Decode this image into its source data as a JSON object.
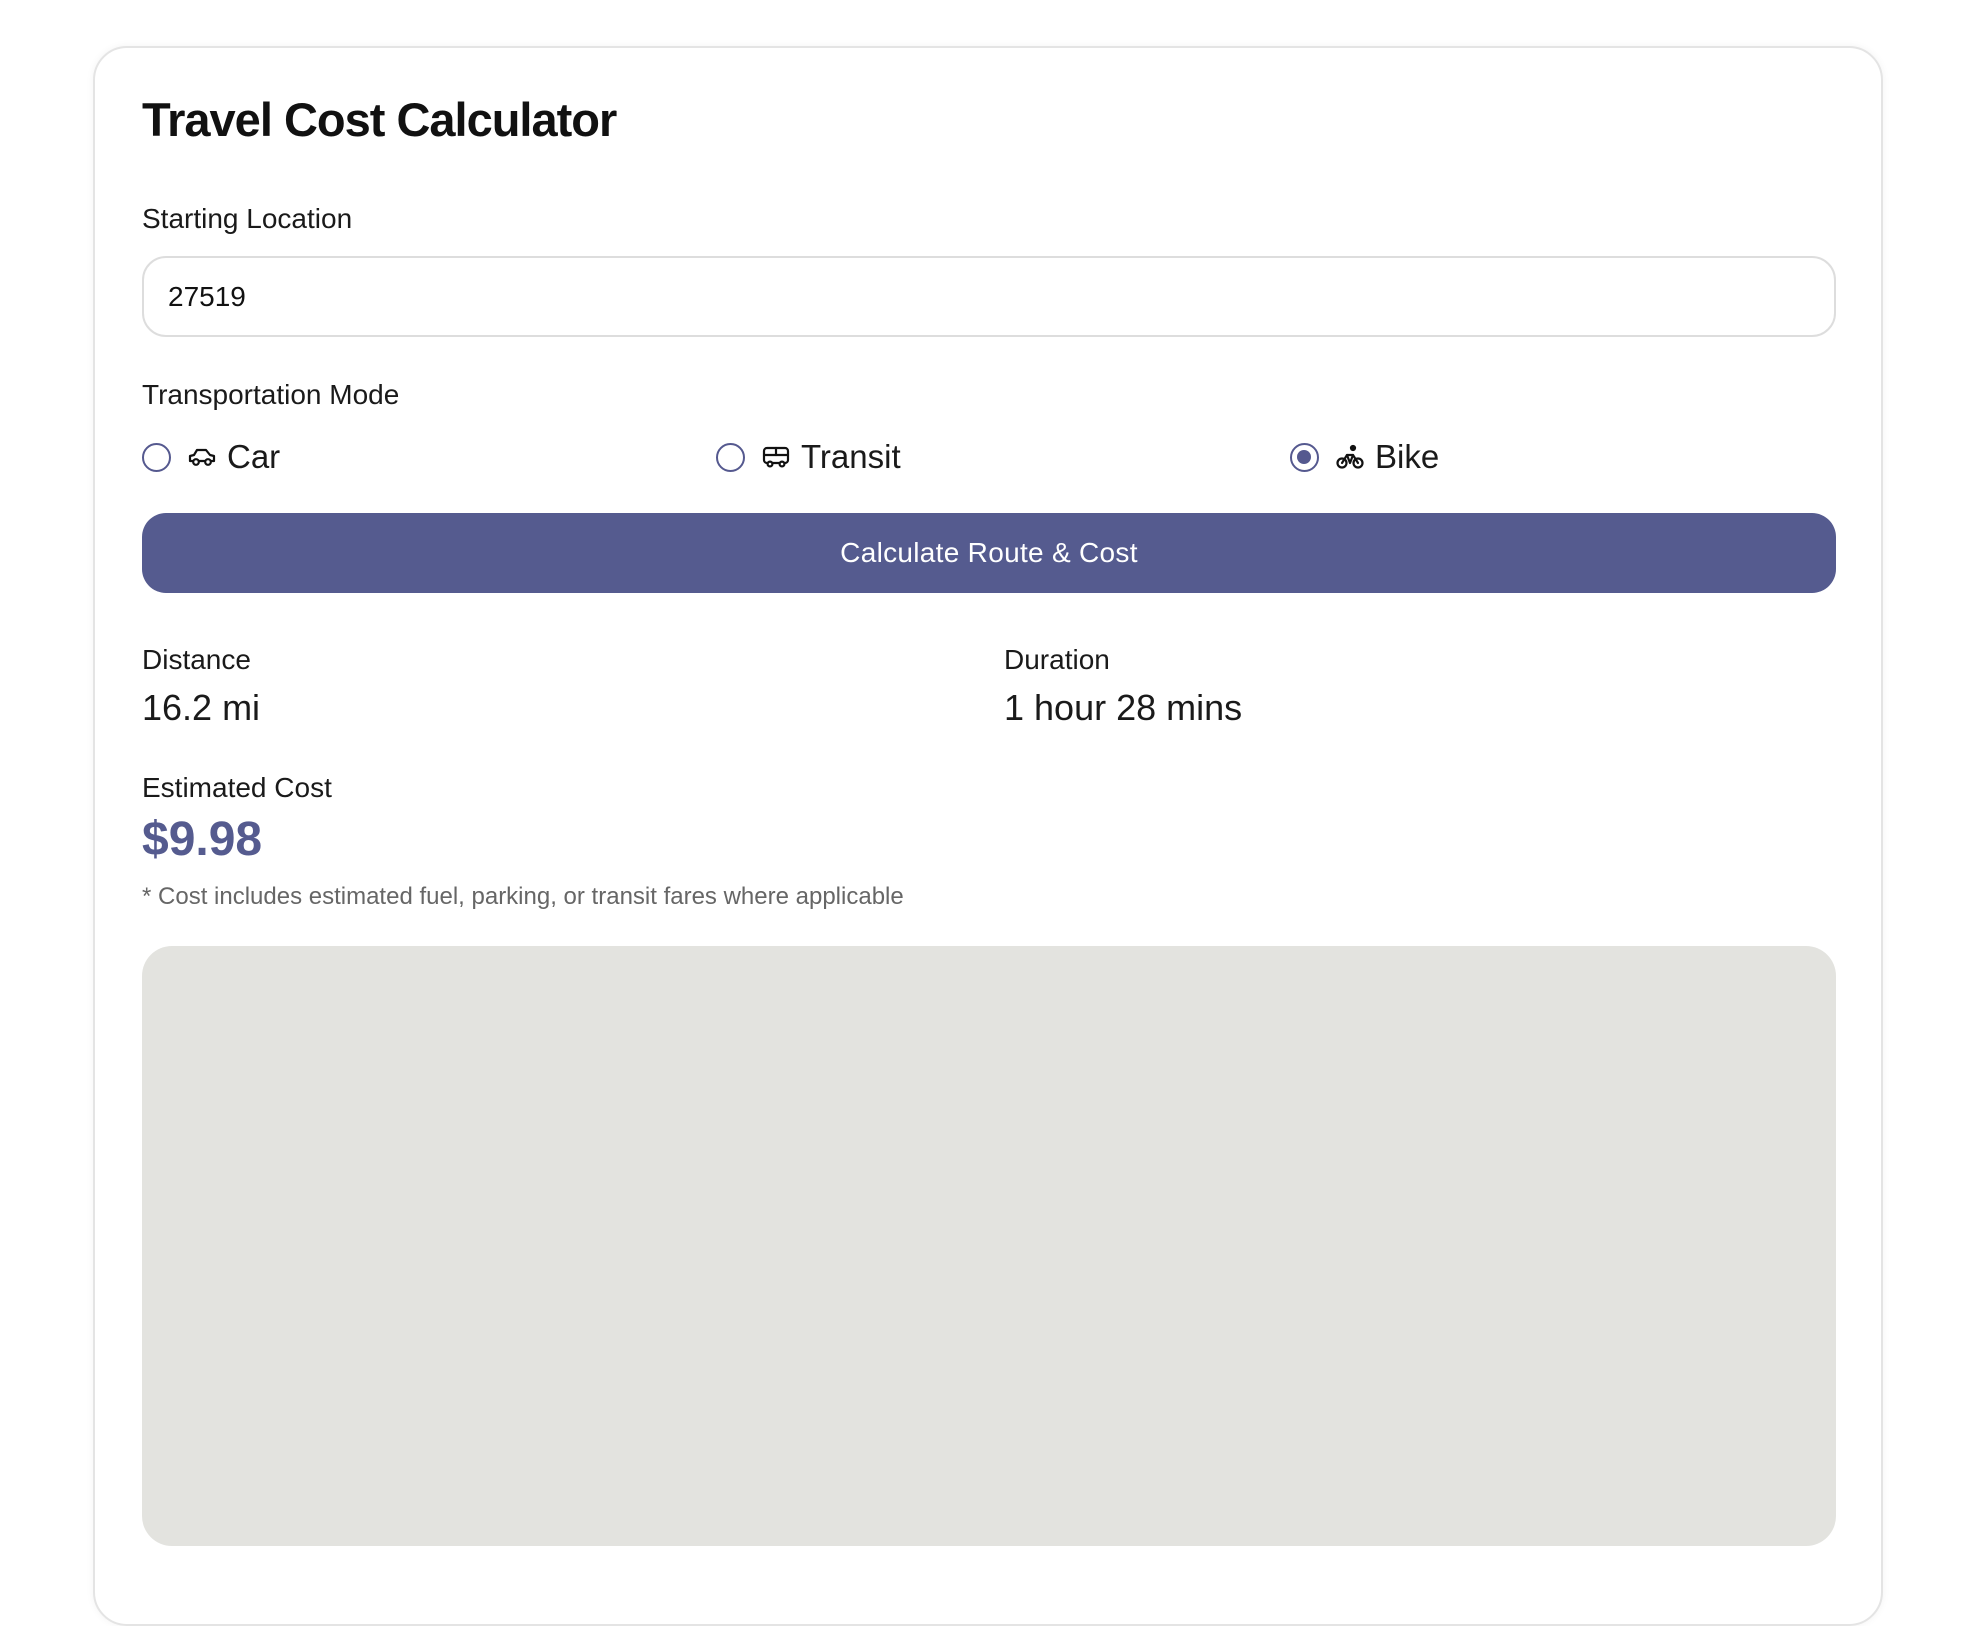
{
  "title": "Travel Cost Calculator",
  "start": {
    "label": "Starting Location",
    "value": "27519"
  },
  "mode": {
    "label": "Transportation Mode",
    "options": [
      {
        "label": "Car",
        "icon": "car-icon",
        "selected": false
      },
      {
        "label": "Transit",
        "icon": "bus-icon",
        "selected": false
      },
      {
        "label": "Bike",
        "icon": "bike-icon",
        "selected": true
      }
    ]
  },
  "button": {
    "label": "Calculate Route & Cost"
  },
  "results": {
    "distance_label": "Distance",
    "distance_value": "16.2 mi",
    "duration_label": "Duration",
    "duration_value": "1 hour 28 mins",
    "cost_label": "Estimated Cost",
    "cost_value": "$9.98",
    "note": "* Cost includes estimated fuel, parking, or transit fares where applicable"
  },
  "colors": {
    "accent": "#555b8f",
    "map_background": "#e3e3df"
  }
}
